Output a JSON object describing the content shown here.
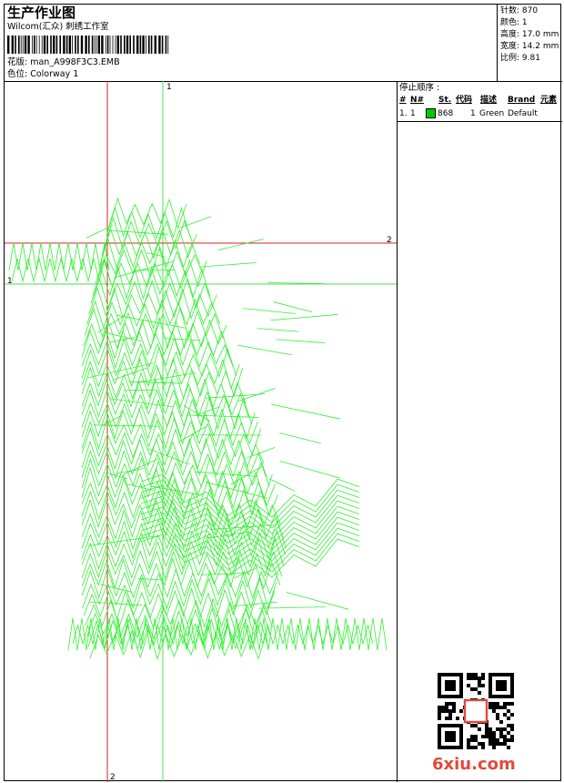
{
  "header": {
    "title": "生产作业图",
    "company": "Wilcom(汇众) 刺绣工作室",
    "design_line": "花版:  man_A998F3C3.EMB",
    "colorway_line": "色位:  Colorway 1"
  },
  "stats": [
    {
      "label": "针数:",
      "value": "870"
    },
    {
      "label": "颜色:",
      "value": "1"
    },
    {
      "label": "高度:",
      "value": "17.0 mm"
    },
    {
      "label": "宽度:",
      "value": "14.2 mm"
    },
    {
      "label": "比例:",
      "value": "9.81"
    }
  ],
  "stop_sequence": {
    "title": "停止顺序 :",
    "headers": {
      "num": "#",
      "n": "N#",
      "st": "St.",
      "code": "代码",
      "desc": "描述",
      "brand": "Brand",
      "elem": "元素"
    },
    "rows": [
      {
        "num": "1.",
        "n": "1",
        "st": "868",
        "code": "1",
        "desc": "Green",
        "brand": "Default",
        "color": "#00cc00"
      }
    ]
  },
  "guides": {
    "h1": "1",
    "h2": "2",
    "v1": "1",
    "v2": "2"
  },
  "colors": {
    "stitch": "#33ee33",
    "guide_green": "#55dd55",
    "guide_red": "#dd2222",
    "watermark": "#e04a3a"
  },
  "watermark": "6xiu.com"
}
